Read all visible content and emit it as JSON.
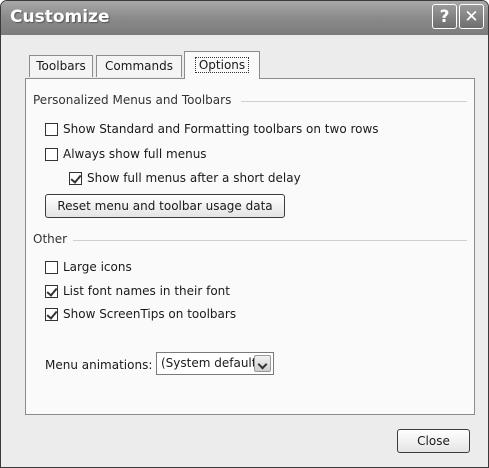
{
  "window": {
    "title": "Customize"
  },
  "titlebar": {
    "help_glyph": "?",
    "close_glyph": "✕"
  },
  "tabs": [
    {
      "label": "Toolbars",
      "active": false
    },
    {
      "label": "Commands",
      "active": false
    },
    {
      "label": "Options",
      "active": true
    }
  ],
  "personalized": {
    "heading": "Personalized Menus and Toolbars",
    "options": [
      {
        "label": "Show Standard and Formatting toolbars on two rows",
        "checked": false
      },
      {
        "label": "Always show full menus",
        "checked": false
      },
      {
        "label": "Show full menus after a short delay",
        "checked": true
      }
    ],
    "reset_label": "Reset menu and toolbar usage data"
  },
  "other": {
    "heading": "Other",
    "options": [
      {
        "label": "Large icons",
        "checked": false
      },
      {
        "label": "List font names in their font",
        "checked": true
      },
      {
        "label": "Show ScreenTips on toolbars",
        "checked": true
      }
    ]
  },
  "menu_animations": {
    "label": "Menu animations:",
    "value": "(System default)"
  },
  "footer": {
    "close_label": "Close"
  }
}
